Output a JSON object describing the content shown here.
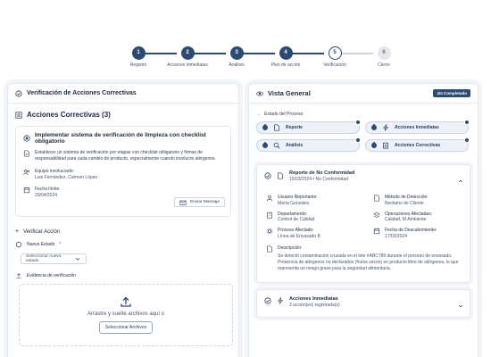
{
  "stepper": {
    "steps": [
      {
        "num": "1",
        "label": "Registro",
        "state": "done"
      },
      {
        "num": "2",
        "label": "Acciones inmediatas",
        "state": "done"
      },
      {
        "num": "3",
        "label": "Análisis",
        "state": "done"
      },
      {
        "num": "4",
        "label": "Plan de acción",
        "state": "done"
      },
      {
        "num": "5",
        "label": "Verificación",
        "state": "current"
      },
      {
        "num": "6",
        "label": "Cierre",
        "state": "pending"
      }
    ]
  },
  "left": {
    "title": "Verificación de Acciones Correctivas",
    "section_title": "Acciones Correctivas (3)",
    "action": {
      "title": "Implementar sistema de verificación de limpieza con checklist obligatorio",
      "description": "Establecer un sistema de verificación por etapas con checklist obligatorio y firmas de responsabilidad para cada cambio de producto, especialmente cuando involucre alérgenos.",
      "team_label": "Equipo involucrado:",
      "team_value": "Luis Fernández, Carmen López",
      "deadline_label": "Fecha límite:",
      "deadline_value": "29/04/2024",
      "send_button": "Enviar Mensaje"
    },
    "verify_title": "Verificar Acción",
    "new_state_label": "Nuevo Estado",
    "required_mark": "*",
    "select_placeholder": "Seleccionar nuevo estado",
    "evidence_label": "Evidencia de verificación",
    "drop_text": "Arrastre y suelte archivos aquí o",
    "files_button": "Seleccionar Archivos"
  },
  "right": {
    "title": "Vista General",
    "badge": "4/4 Completado",
    "process_state_label": "Estado del Proceso",
    "chips": [
      "Reporte",
      "Acciones Inmediatas",
      "Análisis",
      "Acciones Correctivas"
    ],
    "report": {
      "title": "Reporte de No Conformidad",
      "subtitle": "15/03/2024 • No Conformidad",
      "fields": [
        {
          "label": "Usuario Reportante:",
          "value": "María González"
        },
        {
          "label": "Método de Detección:",
          "value": "Reclamo de Cliente"
        },
        {
          "label": "Departamento:",
          "value": "Control de Calidad"
        },
        {
          "label": "Operaciones Afectadas:",
          "value": "Calidad, M.Ambiente"
        },
        {
          "label": "Proceso Afectado:",
          "value": "Línea de Envasado B"
        },
        {
          "label": "Fecha de Descubrimiento:",
          "value": "17/03/2024"
        }
      ],
      "description_label": "Descripción:",
      "description": "Se detectó contaminación cruzada en el lote #ABC789 durante el proceso de envasado. Presencia de alérgenos no declarados (frutos secos) en producto libre de alérgenos, lo que representa un riesgo grave para la seguridad alimentaria."
    },
    "immediate": {
      "title": "Acciones Inmediatas",
      "subtitle": "3 acción(es) registrada(s)"
    }
  },
  "colors": {
    "primary": "#2c4a72",
    "chip_bg": "#eef2f8",
    "required": "#dc2626"
  }
}
